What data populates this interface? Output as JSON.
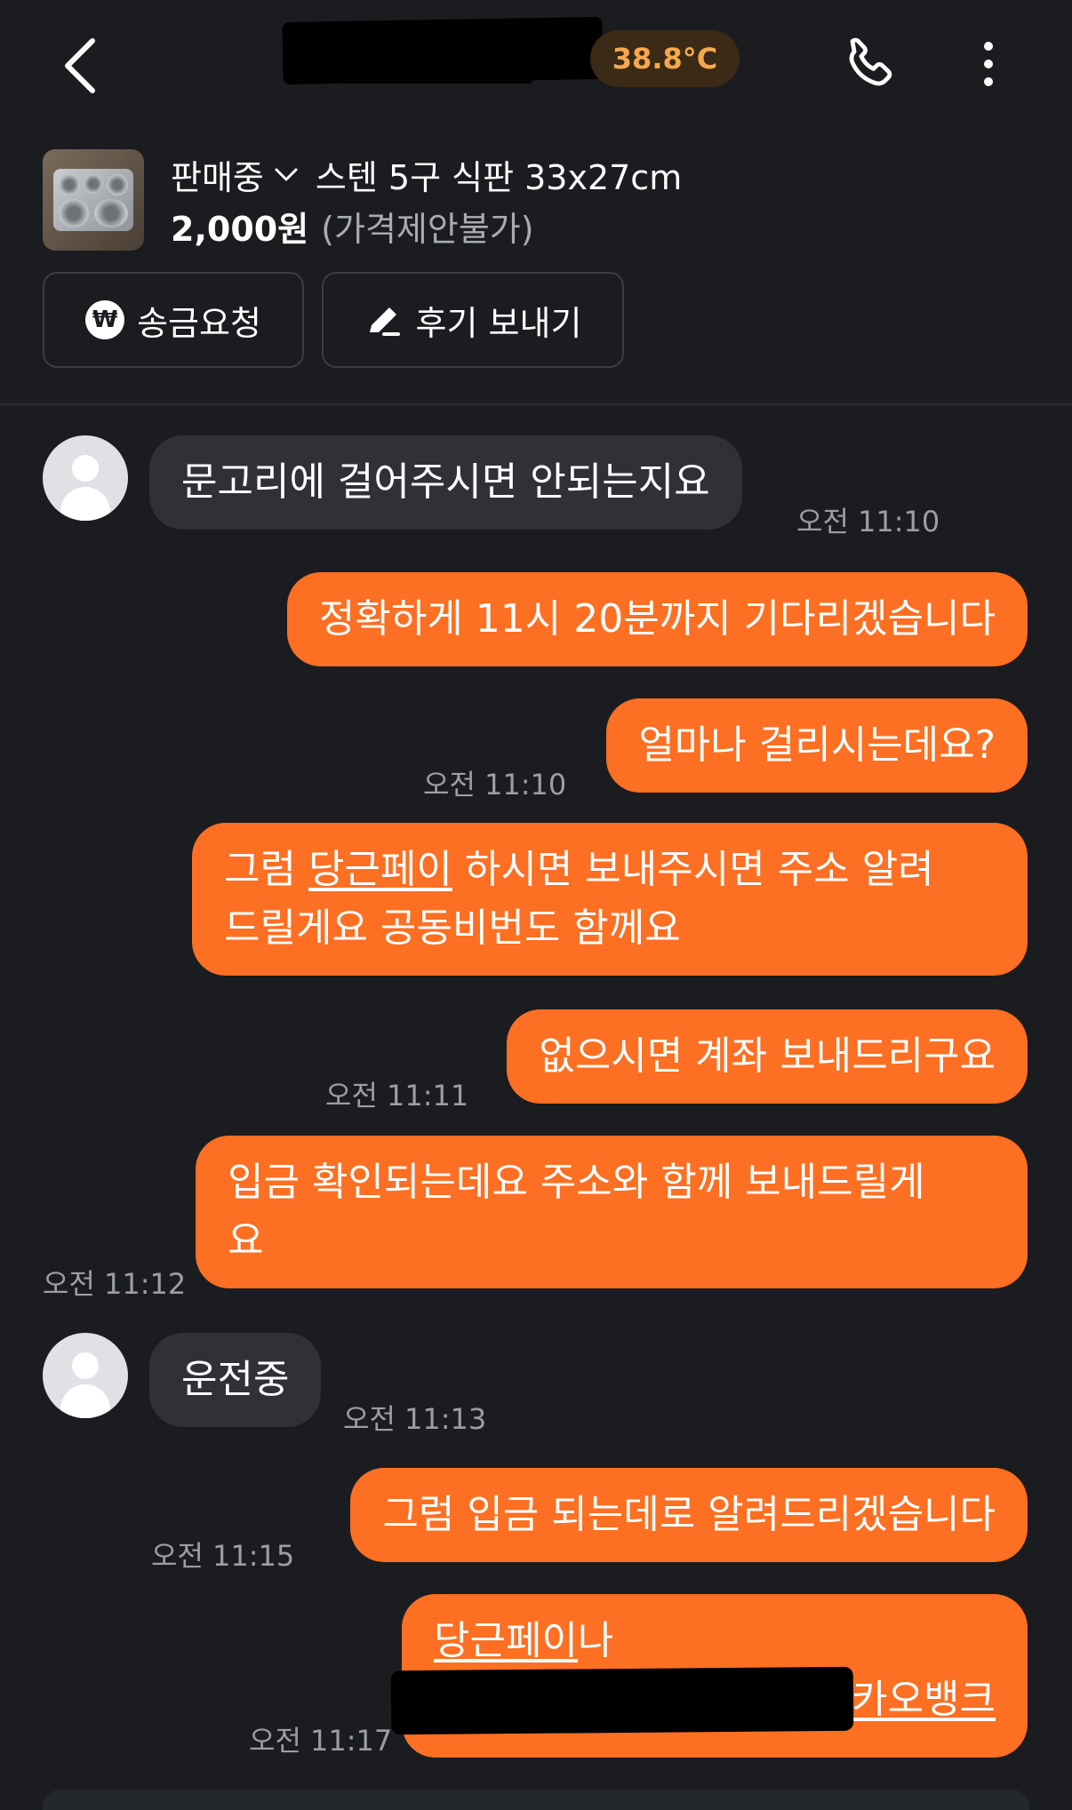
{
  "header": {
    "temperature": "38.8°C"
  },
  "product": {
    "status": "판매중",
    "title": "스텐 5구 식판 33x27cm",
    "price": "2,000원",
    "price_note": "(가격제안불가)"
  },
  "actions": {
    "remit_label": "송금요청",
    "review_label": "후기 보내기",
    "won_glyph": "₩"
  },
  "messages": [
    {
      "side": "in",
      "text": "문고리에 걸어주시면 안되는지요",
      "time": "오전 11:10"
    },
    {
      "side": "out",
      "text": "정확하게 11시 20분까지 기다리겠습니다"
    },
    {
      "side": "out",
      "text": "얼마나 걸리시는데요?",
      "time": "오전 11:10"
    },
    {
      "side": "out",
      "line1_pre": "그럼 ",
      "line1_link": "당근페이",
      "line1_post": " 하시면 보내주시면 주소 알려",
      "line2": "드릴게요 공동비번도 함께요"
    },
    {
      "side": "out",
      "text": "없으시면 계좌 보내드리구요",
      "time": "오전 11:11"
    },
    {
      "side": "out",
      "line1": "입금 확인되는데요 주소와 함께 보내드릴게",
      "line2": "요",
      "time": "오전 11:12"
    },
    {
      "side": "in",
      "text": "운전중",
      "time": "오전 11:13"
    },
    {
      "side": "out",
      "text": "그럼 입금 되는데로 알려드리겠습니다",
      "time": "오전 11:15"
    },
    {
      "side": "out",
      "line1_link": "당근페이",
      "line1_post": "나",
      "line2_link": "카오뱅크",
      "time": "오전 11:17"
    }
  ],
  "colors": {
    "background": "#1b1c20",
    "incoming_bubble": "#2f3137",
    "outgoing_bubble": "#fd6f22",
    "temperature_text": "#f6a84d",
    "timestamp": "#9c9ea5"
  }
}
